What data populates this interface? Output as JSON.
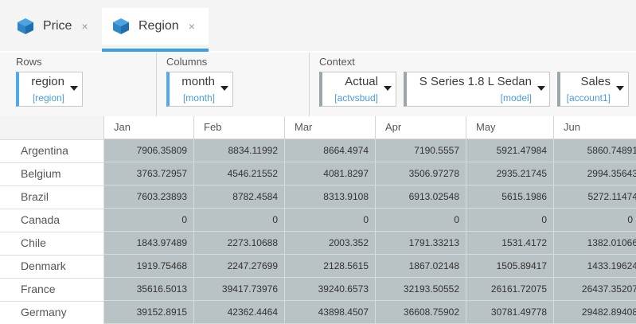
{
  "tabs": [
    {
      "label": "Price",
      "close": "×",
      "active": false
    },
    {
      "label": "Region",
      "close": "×",
      "active": true
    }
  ],
  "controls": {
    "rows": {
      "title": "Rows",
      "value": "region",
      "sub": "[region]"
    },
    "columns": {
      "title": "Columns",
      "value": "month",
      "sub": "[month]"
    },
    "context": {
      "title": "Context",
      "items": [
        {
          "value": "Actual",
          "sub": "[actvsbud]"
        },
        {
          "value": "S Series 1.8 L Sedan",
          "sub": "[model]"
        },
        {
          "value": "Sales",
          "sub": "[account1]"
        }
      ]
    }
  },
  "grid": {
    "columns": [
      "Jan",
      "Feb",
      "Mar",
      "Apr",
      "May",
      "Jun"
    ],
    "rows": [
      {
        "label": "Argentina",
        "values": [
          "7906.35809",
          "8834.11992",
          "8664.4974",
          "7190.5557",
          "5921.47984",
          "5860.74891"
        ]
      },
      {
        "label": "Belgium",
        "values": [
          "3763.72957",
          "4546.21552",
          "4081.8297",
          "3506.97278",
          "2935.21745",
          "2994.35643"
        ]
      },
      {
        "label": "Brazil",
        "values": [
          "7603.23893",
          "8782.4584",
          "8313.9108",
          "6913.02548",
          "5615.1986",
          "5272.11474"
        ]
      },
      {
        "label": "Canada",
        "values": [
          "0",
          "0",
          "0",
          "0",
          "0",
          "0"
        ]
      },
      {
        "label": "Chile",
        "values": [
          "1843.97489",
          "2273.10688",
          "2003.352",
          "1791.33213",
          "1531.4172",
          "1382.01066"
        ]
      },
      {
        "label": "Denmark",
        "values": [
          "1919.75468",
          "2247.27699",
          "2128.5615",
          "1867.02148",
          "1505.89417",
          "1433.19624"
        ]
      },
      {
        "label": "France",
        "values": [
          "35616.5013",
          "39417.73976",
          "39240.6573",
          "32193.50552",
          "26161.72075",
          "26437.35207"
        ]
      },
      {
        "label": "Germany",
        "values": [
          "39152.8915",
          "42362.4464",
          "43898.4507",
          "36608.75902",
          "30781.49778",
          "29482.89408"
        ]
      }
    ]
  }
}
